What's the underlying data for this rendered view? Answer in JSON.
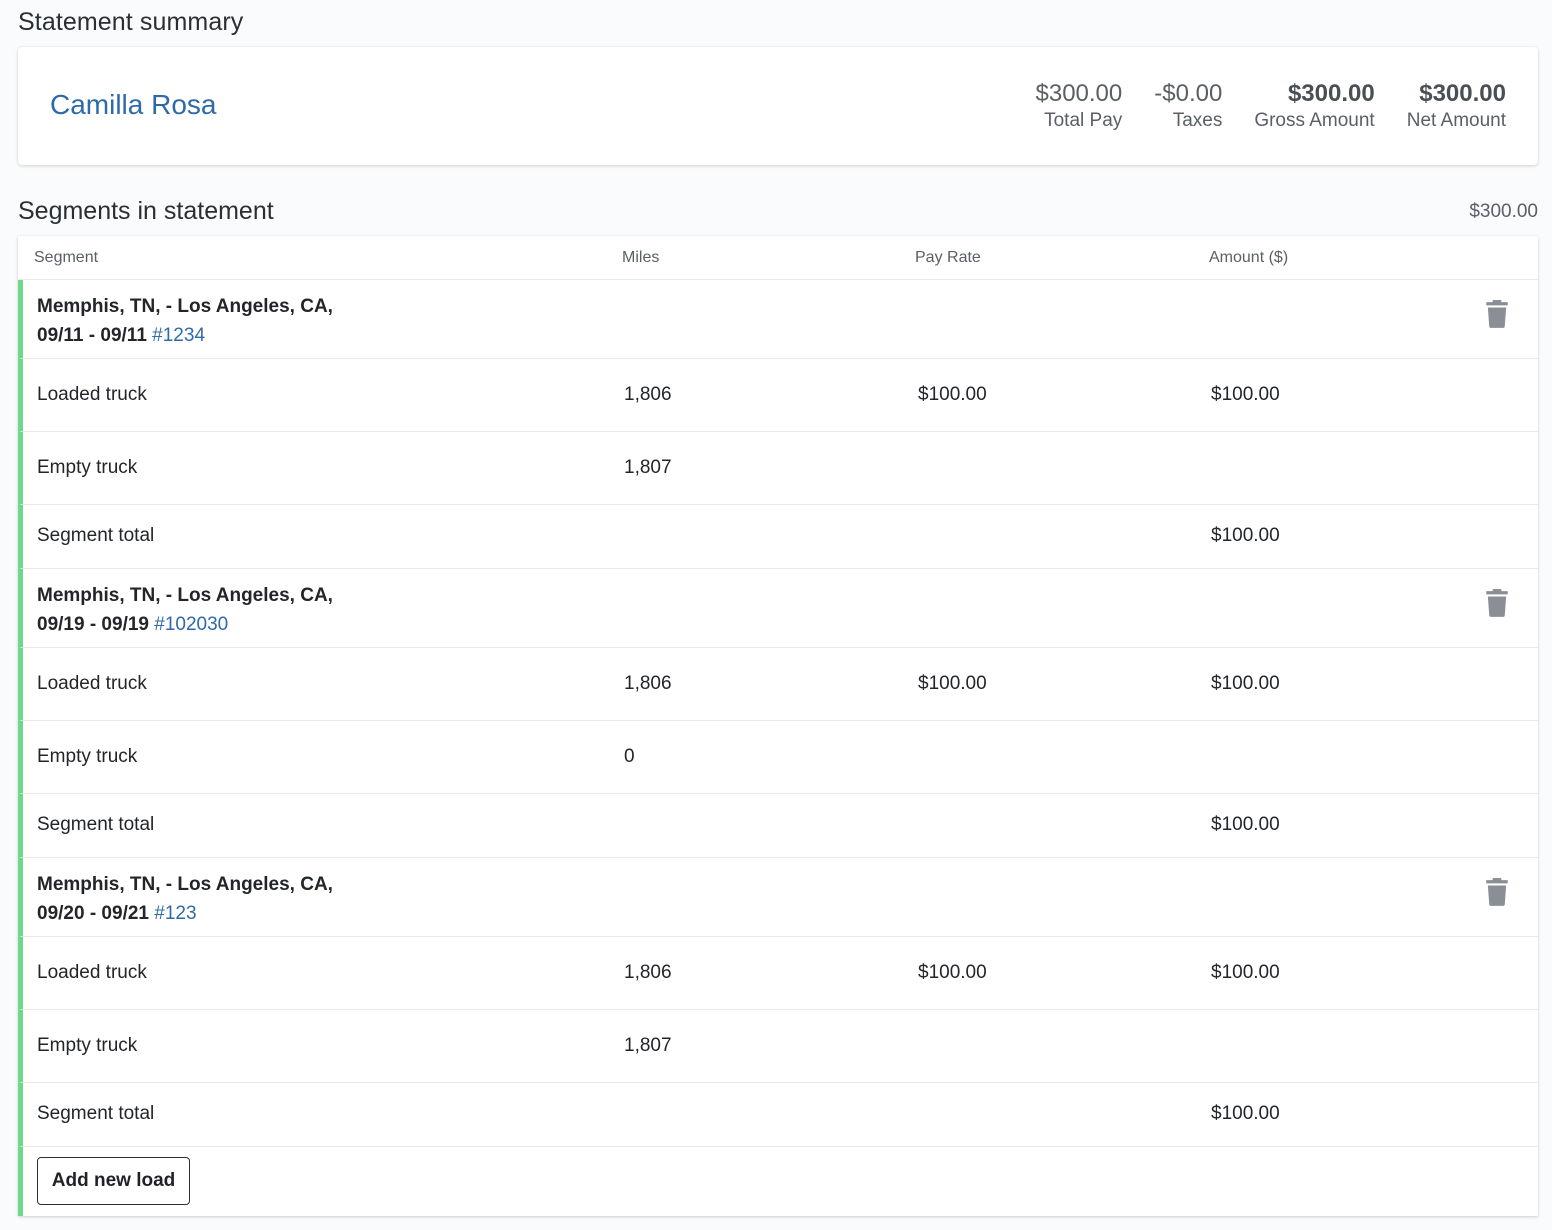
{
  "page": {
    "title": "Statement summary",
    "segments_title": "Segments in statement",
    "segments_total": "$300.00"
  },
  "summary": {
    "driver_name": "Camilla Rosa",
    "total_pay": {
      "value": "$300.00",
      "label": "Total Pay"
    },
    "taxes": {
      "value": "-$0.00",
      "label": "Taxes"
    },
    "gross": {
      "value": "$300.00",
      "label": "Gross Amount"
    },
    "net": {
      "value": "$300.00",
      "label": "Net Amount"
    }
  },
  "table": {
    "columns": [
      "Segment",
      "Miles",
      "Pay Rate",
      "Amount ($)"
    ],
    "segments": [
      {
        "route": "Memphis, TN, - Los Angeles, CA,",
        "dates": "09/11 - 09/11",
        "load_id": "#1234",
        "loaded": {
          "label": "Loaded truck",
          "miles": "1,806",
          "rate": "$100.00",
          "amount": "$100.00"
        },
        "empty": {
          "label": "Empty truck",
          "miles": "1,807"
        },
        "total": {
          "label": "Segment total",
          "amount": "$100.00"
        }
      },
      {
        "route": "Memphis, TN, - Los Angeles, CA,",
        "dates": "09/19 - 09/19",
        "load_id": "#102030",
        "loaded": {
          "label": "Loaded truck",
          "miles": "1,806",
          "rate": "$100.00",
          "amount": "$100.00"
        },
        "empty": {
          "label": "Empty truck",
          "miles": "0"
        },
        "total": {
          "label": "Segment total",
          "amount": "$100.00"
        }
      },
      {
        "route": "Memphis, TN, - Los Angeles, CA,",
        "dates": "09/20 - 09/21",
        "load_id": "#123",
        "loaded": {
          "label": "Loaded truck",
          "miles": "1,806",
          "rate": "$100.00",
          "amount": "$100.00"
        },
        "empty": {
          "label": "Empty truck",
          "miles": "1,807"
        },
        "total": {
          "label": "Segment total",
          "amount": "$100.00"
        }
      }
    ],
    "add_button": "Add new load"
  },
  "icons": {
    "delete": "trash-icon"
  },
  "colors": {
    "accent_link": "#2f6aa8",
    "segment_bar": "#6fd98a",
    "trash": "#8a8f96"
  }
}
